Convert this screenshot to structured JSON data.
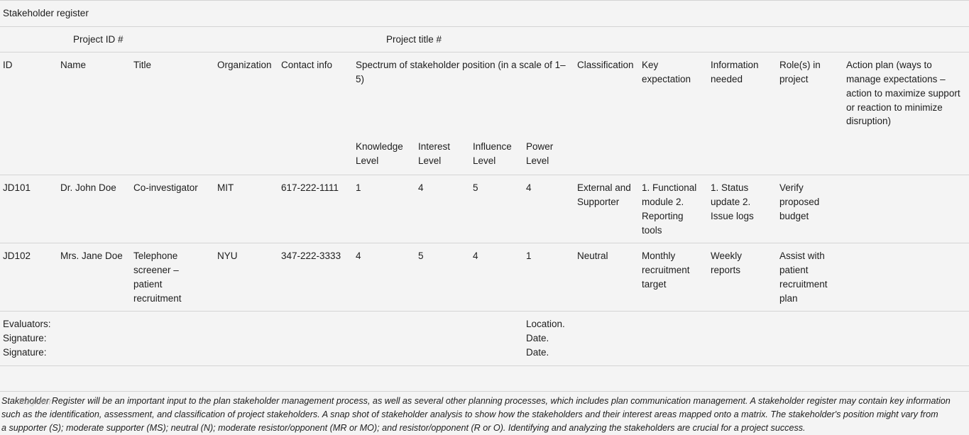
{
  "document": {
    "title": "Stakeholder register"
  },
  "project_bar": {
    "project_id_label": "Project ID #",
    "project_title_label": "Project title #"
  },
  "columns": {
    "id": "ID",
    "name": "Name",
    "title": "Title",
    "organization": "Organization",
    "contact_info": "Contact info",
    "spectrum": "Spectrum of stakeholder position (in a scale of 1–5)",
    "classification": "Classification",
    "key_expectation": "Key expectation",
    "information_needed": "Information needed",
    "role_in_project": "Role(s) in project",
    "action_plan": "Action plan (ways to manage expectations – action to maximize support or reaction to minimize disruption)"
  },
  "subcolumns": {
    "knowledge_level": "Knowledge Level",
    "interest_level": "Interest Level",
    "influence_level": "Influence Level",
    "power_level": "Power Level"
  },
  "rows": [
    {
      "id": "JD101",
      "name": "Dr. John Doe",
      "title": "Co-investigator",
      "organization": "MIT",
      "contact_info": "617-222-1111",
      "knowledge_level": "1",
      "interest_level": "4",
      "influence_level": "5",
      "power_level": "4",
      "classification": "External and Supporter",
      "key_expectation": "1. Functional module 2. Reporting tools",
      "information_needed": "1. Status update 2. Issue logs",
      "role_in_project": "Verify proposed budget",
      "action_plan": ""
    },
    {
      "id": "JD102",
      "name": "Mrs. Jane Doe",
      "title": "Telephone screener – patient recruitment",
      "organization": "NYU",
      "contact_info": "347-222-3333",
      "knowledge_level": "4",
      "interest_level": "5",
      "influence_level": "4",
      "power_level": "1",
      "classification": "Neutral",
      "key_expectation": "Monthly recruitment target",
      "information_needed": "Weekly reports",
      "role_in_project": "Assist with patient recruitment plan",
      "action_plan": ""
    }
  ],
  "signoff": {
    "evaluators_label": "Evaluators:",
    "signature_label_1": "Signature:",
    "signature_label_2": "Signature:",
    "location_label": "Location.",
    "date_label_1": "Date.",
    "date_label_2": "Date."
  },
  "footnote": {
    "line1": "Stakeholder Register will be an important input to the plan stakeholder management process, as well as several other planning processes, which includes plan communication management. A stakeholder register may contain key information",
    "line2": "such as the identification, assessment, and classification of project stakeholders. A snap shot of stakeholder analysis to show how the stakeholders and their interest areas mapped onto a matrix. The stakeholder's position might vary from",
    "line3": "a supporter (S); moderate supporter (MS); neutral (N); moderate resistor/opponent (MR or MO); and resistor/opponent (R or O). Identifying and analyzing the stakeholders are crucial for a project success.",
    "ghost_overlap": "Register"
  },
  "colors": {
    "background": "#f4f4f4",
    "border": "#d4d4d4",
    "text": "#1d1d1d",
    "ghost_text": "#b9b9b9"
  }
}
